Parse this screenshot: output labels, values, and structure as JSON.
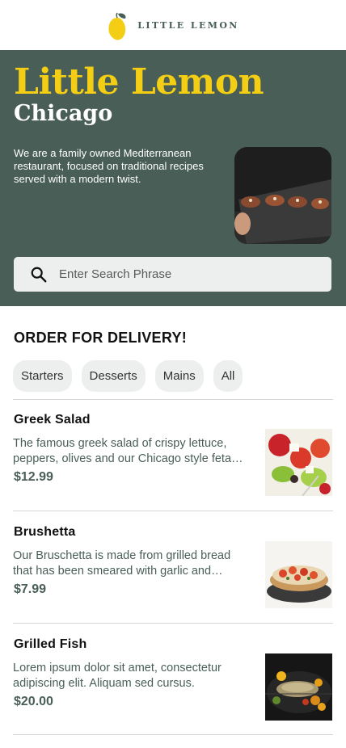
{
  "header": {
    "logo_icon": "lemon-icon",
    "logo_text": "LITTLE LEMON"
  },
  "hero": {
    "title": "Little Lemon",
    "subtitle": "Chicago",
    "description": "We are a family owned Mediterranean restaurant, focused on traditional recipes served with a modern twist.",
    "image_icon": "hero-food-image"
  },
  "search": {
    "icon": "search-icon",
    "placeholder": "Enter Search Phrase",
    "value": ""
  },
  "order": {
    "title": "ORDER FOR DELIVERY!",
    "categories": [
      "Starters",
      "Desserts",
      "Mains",
      "All"
    ]
  },
  "menu": [
    {
      "name": "Greek Salad",
      "description": "The famous greek salad of crispy lettuce, peppers, olives and our Chicago style feta cheese, garnished with crunchy garlic and rosemary croutons.",
      "price": "$12.99",
      "image_icon": "greek-salad-image"
    },
    {
      "name": "Brushetta",
      "description": "Our Bruschetta is made from grilled bread that has been smeared with garlic and seasoned with salt and olive oil.",
      "price": "$7.99",
      "image_icon": "bruschetta-image"
    },
    {
      "name": "Grilled Fish",
      "description": "Lorem ipsum dolor sit amet, consectetur adipiscing elit. Aliquam sed cursus.",
      "price": "$20.00",
      "image_icon": "grilled-fish-image"
    }
  ],
  "colors": {
    "primary_green": "#495e57",
    "primary_yellow": "#f4ce14",
    "chip_background": "#edefee"
  }
}
